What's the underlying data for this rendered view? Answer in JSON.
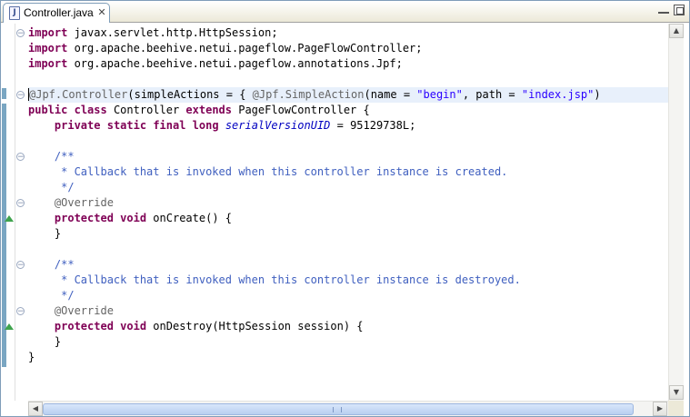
{
  "tab": {
    "title": "Controller.java",
    "icon": "J",
    "close": "✕"
  },
  "code_lines": [
    [
      {
        "t": "import",
        "c": "kw"
      },
      {
        "t": " javax.servlet.http.HttpSession;",
        "c": ""
      }
    ],
    [
      {
        "t": "import",
        "c": "kw"
      },
      {
        "t": " org.apache.beehive.netui.pageflow.PageFlowController;",
        "c": ""
      }
    ],
    [
      {
        "t": "import",
        "c": "kw"
      },
      {
        "t": " org.apache.beehive.netui.pageflow.annotations.Jpf;",
        "c": ""
      }
    ],
    [],
    [
      {
        "t": "@Jpf.Controller",
        "c": "ann"
      },
      {
        "t": "(simpleActions = { ",
        "c": ""
      },
      {
        "t": "@Jpf.SimpleAction",
        "c": "ann"
      },
      {
        "t": "(name = ",
        "c": ""
      },
      {
        "t": "\"begin\"",
        "c": "str"
      },
      {
        "t": ", path = ",
        "c": ""
      },
      {
        "t": "\"index.jsp\"",
        "c": "str"
      },
      {
        "t": ")",
        "c": ""
      }
    ],
    [
      {
        "t": "public",
        "c": "kw"
      },
      {
        "t": " ",
        "c": ""
      },
      {
        "t": "class",
        "c": "kw"
      },
      {
        "t": " Controller ",
        "c": ""
      },
      {
        "t": "extends",
        "c": "kw"
      },
      {
        "t": " PageFlowController {",
        "c": ""
      }
    ],
    [
      {
        "t": "    ",
        "c": ""
      },
      {
        "t": "private",
        "c": "kw"
      },
      {
        "t": " ",
        "c": ""
      },
      {
        "t": "static",
        "c": "kw"
      },
      {
        "t": " ",
        "c": ""
      },
      {
        "t": "final",
        "c": "kw"
      },
      {
        "t": " ",
        "c": ""
      },
      {
        "t": "long",
        "c": "kw"
      },
      {
        "t": " ",
        "c": ""
      },
      {
        "t": "serialVersionUID",
        "c": "field"
      },
      {
        "t": " = 95129738L;",
        "c": ""
      }
    ],
    [],
    [
      {
        "t": "    /**",
        "c": "cmt"
      }
    ],
    [
      {
        "t": "     * Callback that is invoked when this controller instance is created.",
        "c": "cmt"
      }
    ],
    [
      {
        "t": "     */",
        "c": "cmt"
      }
    ],
    [
      {
        "t": "    ",
        "c": ""
      },
      {
        "t": "@Override",
        "c": "ann"
      }
    ],
    [
      {
        "t": "    ",
        "c": ""
      },
      {
        "t": "protected",
        "c": "kw"
      },
      {
        "t": " ",
        "c": ""
      },
      {
        "t": "void",
        "c": "kw"
      },
      {
        "t": " onCreate() {",
        "c": ""
      }
    ],
    [
      {
        "t": "    }",
        "c": ""
      }
    ],
    [],
    [
      {
        "t": "    /**",
        "c": "cmt"
      }
    ],
    [
      {
        "t": "     * Callback that is invoked when this controller instance is destroyed.",
        "c": "cmt"
      }
    ],
    [
      {
        "t": "     */",
        "c": "cmt"
      }
    ],
    [
      {
        "t": "    ",
        "c": ""
      },
      {
        "t": "@Override",
        "c": "ann"
      }
    ],
    [
      {
        "t": "    ",
        "c": ""
      },
      {
        "t": "protected",
        "c": "kw"
      },
      {
        "t": " ",
        "c": ""
      },
      {
        "t": "void",
        "c": "kw"
      },
      {
        "t": " onDestroy(HttpSession session) {",
        "c": ""
      }
    ],
    [
      {
        "t": "    }",
        "c": ""
      }
    ],
    [
      {
        "t": "}",
        "c": ""
      }
    ]
  ],
  "gutter": {
    "fold_marker": "⊖",
    "fold_lines": [
      0,
      4,
      8,
      11,
      15,
      18
    ],
    "override_lines": [
      12,
      19
    ],
    "current_line": 4
  },
  "scrollbar": {
    "up": "▲",
    "down": "▼",
    "left": "◀",
    "right": "▶"
  },
  "colors": {
    "keyword": "#7f0055",
    "string": "#2a00ff",
    "annotation": "#646464",
    "comment": "#3f5fbf",
    "field": "#0000c0"
  },
  "icons": {
    "tab": "java-file-icon",
    "minimize": "minimize-icon",
    "maximize": "maximize-icon"
  }
}
